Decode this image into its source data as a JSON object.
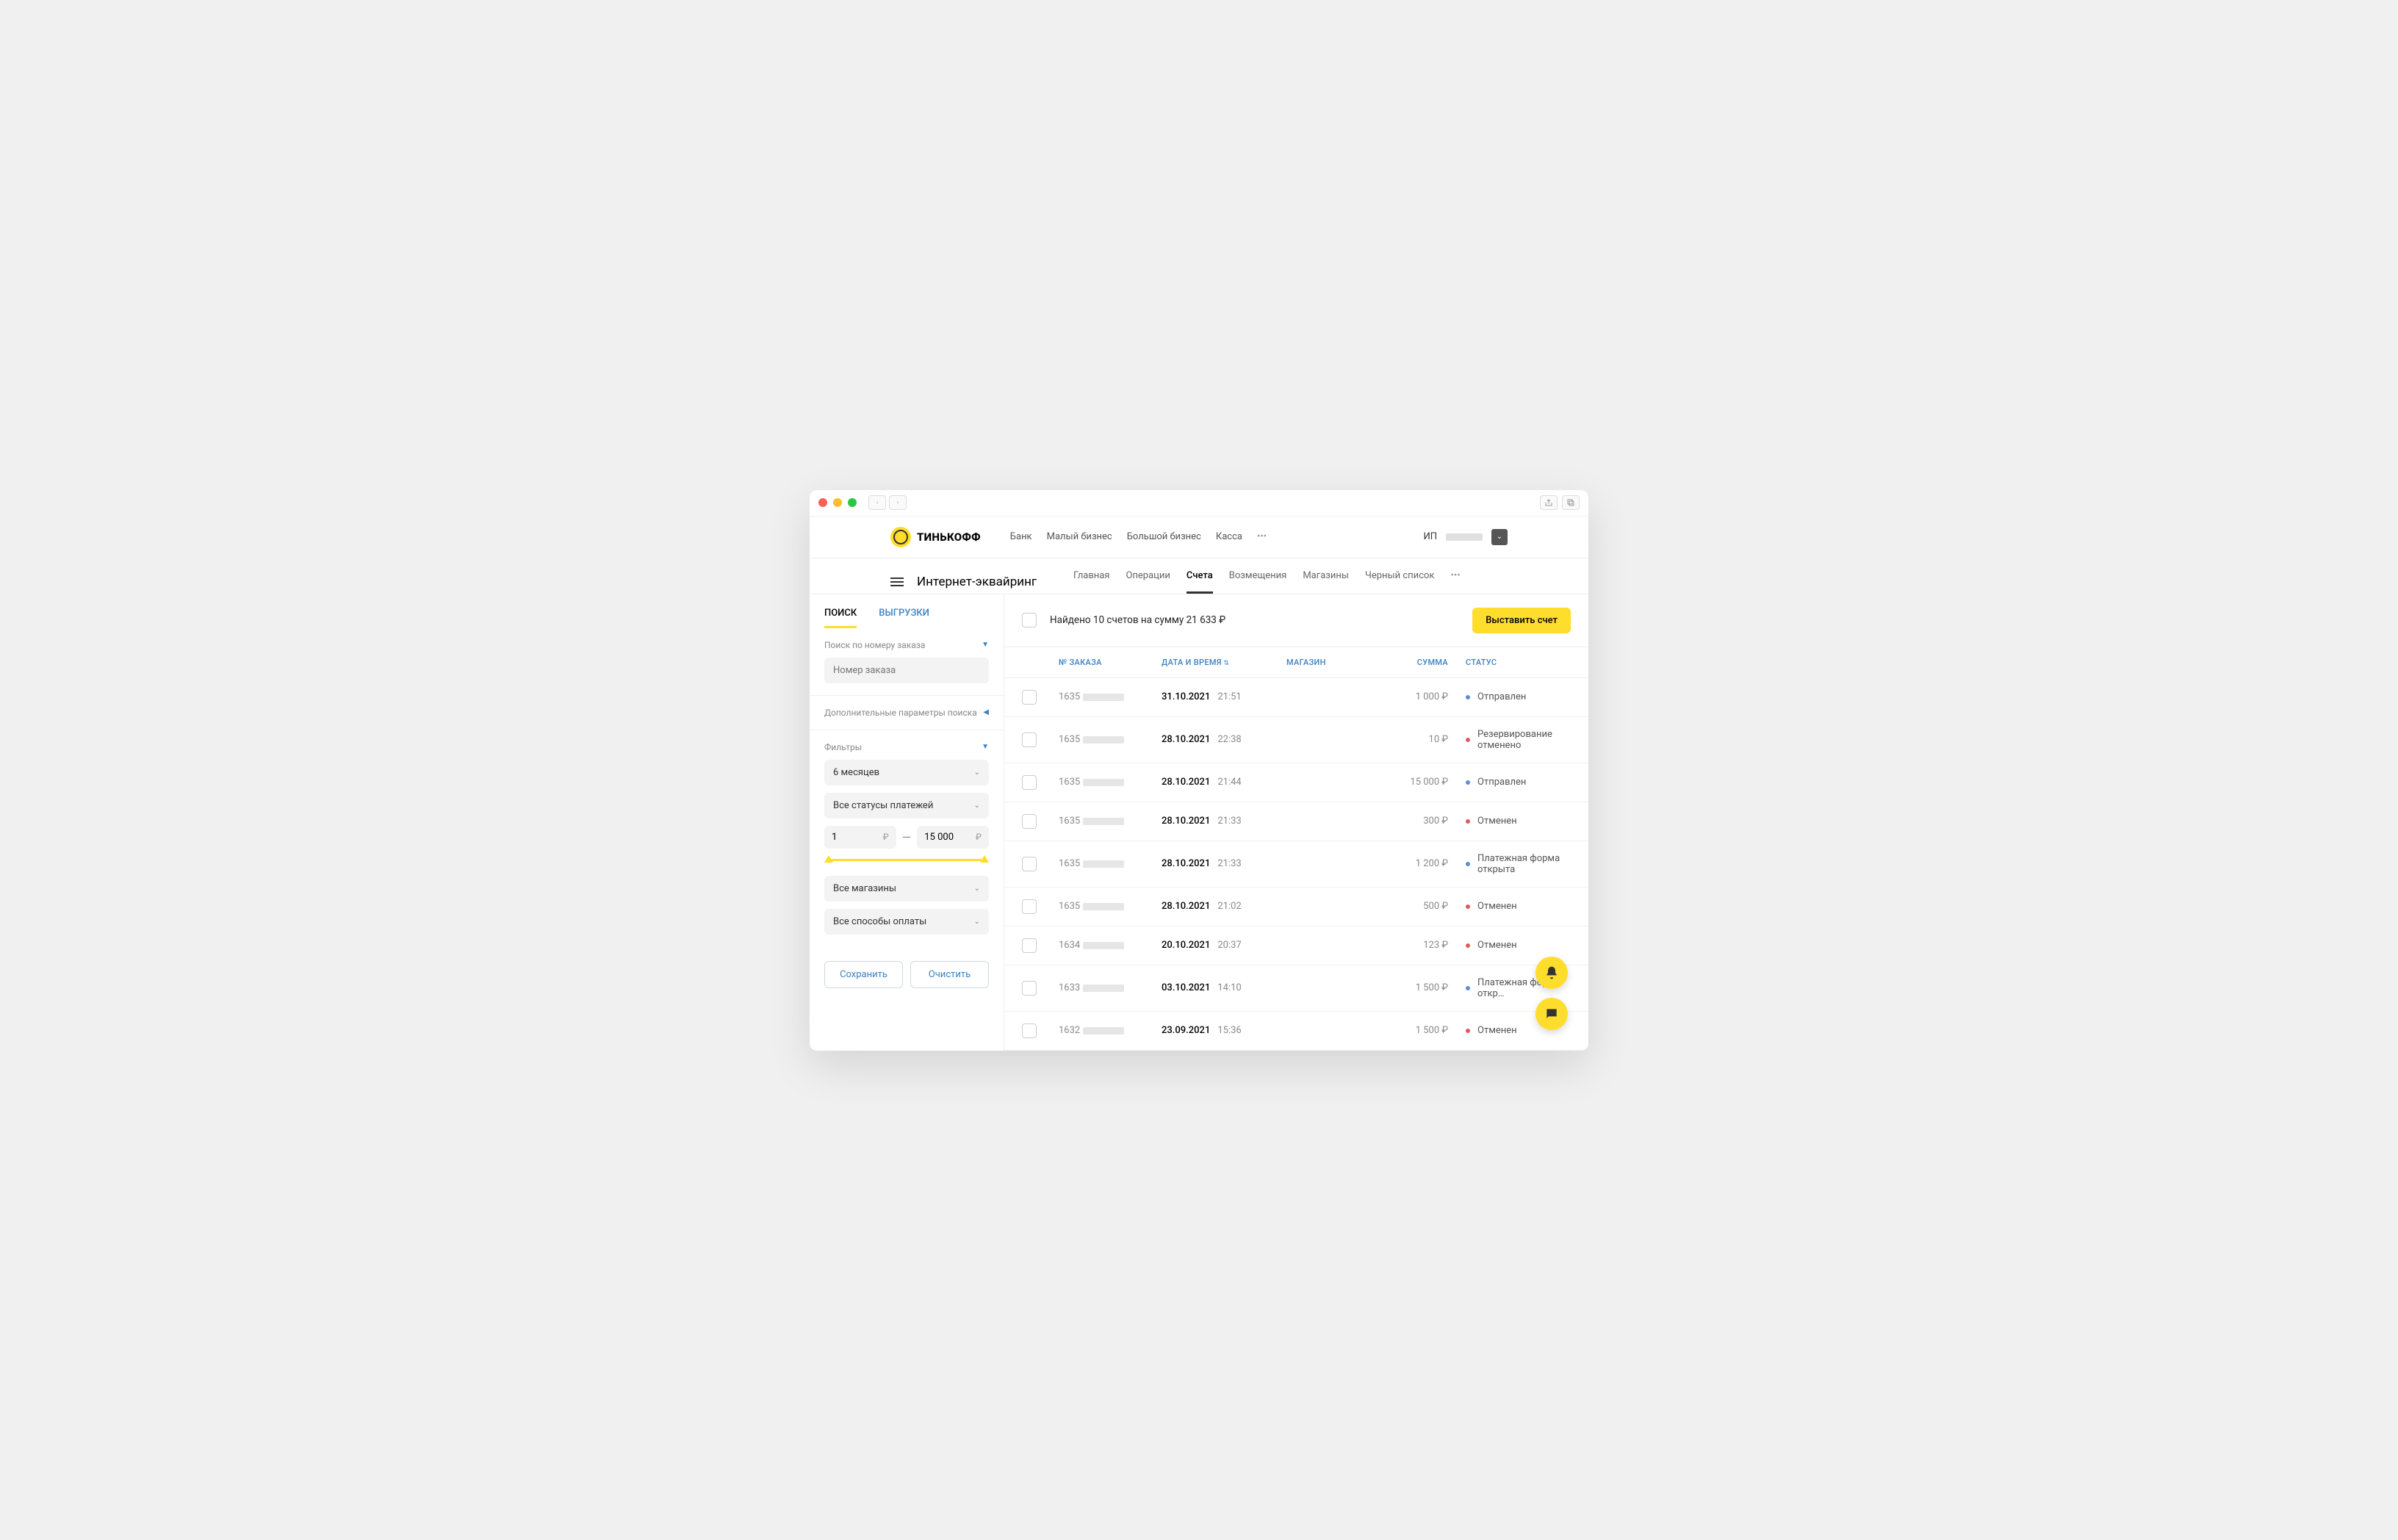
{
  "brand": "ТИНЬКОФФ",
  "top_nav": {
    "bank": "Банк",
    "small": "Малый бизнес",
    "big": "Большой бизнес",
    "kassa": "Касса"
  },
  "user_prefix": "ИП",
  "page_title": "Интернет-эквайринг",
  "sub_nav": {
    "main": "Главная",
    "ops": "Операции",
    "invoices": "Счета",
    "refunds": "Возмещения",
    "shops": "Магазины",
    "blacklist": "Черный список"
  },
  "side_tabs": {
    "search": "ПОИСК",
    "exports": "ВЫГРУЗКИ"
  },
  "search_by_label": "Поиск по номеру заказа",
  "order_placeholder": "Номер заказа",
  "extra_params": "Дополнительные параметры поиска",
  "filters_label": "Фильтры",
  "period": "6 месяцев",
  "status_filter": "Все статусы платежей",
  "range_from": "1",
  "range_to": "15 000",
  "currency": "₽",
  "shops_filter": "Все магазины",
  "payment_filter": "Все способы оплаты",
  "save_btn": "Сохранить",
  "clear_btn": "Очистить",
  "summary": "Найдено 10 счетов на сумму 21 633 ₽",
  "create_invoice": "Выставить счет",
  "cols": {
    "order": "№ ЗАКАЗА",
    "datetime": "ДАТА И ВРЕМЯ",
    "shop": "МАГАЗИН",
    "sum": "СУММА",
    "status": "СТАТУС"
  },
  "rows": [
    {
      "order_prefix": "1635",
      "date": "31.10.2021",
      "time": "21:51",
      "sum": "1 000 ₽",
      "status": "Отправлен",
      "dot": "blue"
    },
    {
      "order_prefix": "1635",
      "date": "28.10.2021",
      "time": "22:38",
      "sum": "10 ₽",
      "status": "Резервирование отменено",
      "dot": "red"
    },
    {
      "order_prefix": "1635",
      "date": "28.10.2021",
      "time": "21:44",
      "sum": "15 000 ₽",
      "status": "Отправлен",
      "dot": "blue"
    },
    {
      "order_prefix": "1635",
      "date": "28.10.2021",
      "time": "21:33",
      "sum": "300 ₽",
      "status": "Отменен",
      "dot": "red"
    },
    {
      "order_prefix": "1635",
      "date": "28.10.2021",
      "time": "21:33",
      "sum": "1 200 ₽",
      "status": "Платежная форма открыта",
      "dot": "blue"
    },
    {
      "order_prefix": "1635",
      "date": "28.10.2021",
      "time": "21:02",
      "sum": "500 ₽",
      "status": "Отменен",
      "dot": "red"
    },
    {
      "order_prefix": "1634",
      "date": "20.10.2021",
      "time": "20:37",
      "sum": "123 ₽",
      "status": "Отменен",
      "dot": "red"
    },
    {
      "order_prefix": "1633",
      "date": "03.10.2021",
      "time": "14:10",
      "sum": "1 500 ₽",
      "status": "Платежная форма откр…",
      "dot": "blue"
    },
    {
      "order_prefix": "1632",
      "date": "23.09.2021",
      "time": "15:36",
      "sum": "1 500 ₽",
      "status": "Отменен",
      "dot": "red"
    }
  ]
}
